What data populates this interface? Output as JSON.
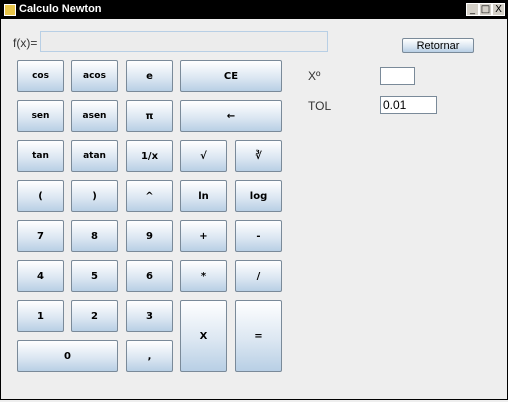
{
  "window": {
    "title": "Calculo Newton",
    "minimize": "_",
    "maximize": "□",
    "close": "X"
  },
  "fx": {
    "label": "f(x)=",
    "value": ""
  },
  "buttons": {
    "cos": "cos",
    "acos": "acos",
    "e": "e",
    "ce": "CE",
    "sen": "sen",
    "asen": "asen",
    "pi": "π",
    "backspace": "←",
    "tan": "tan",
    "atan": "atan",
    "inverse": "1/x",
    "sqrt": "√",
    "cbrt": "∛",
    "open_paren": "(",
    "close_paren": ")",
    "power": "^",
    "ln": "ln",
    "log": "log",
    "seven": "7",
    "eight": "8",
    "nine": "9",
    "plus": "+",
    "minus": "-",
    "four": "4",
    "five": "5",
    "six": "6",
    "multiply": "*",
    "divide": "/",
    "one": "1",
    "two": "2",
    "three": "3",
    "x": "X",
    "equals": "=",
    "zero": "0",
    "comma": ","
  },
  "side": {
    "retornar": "Retornar",
    "x0_label": "Xº",
    "x0_value": "",
    "tol_label": "TOL",
    "tol_value": "0.01"
  }
}
